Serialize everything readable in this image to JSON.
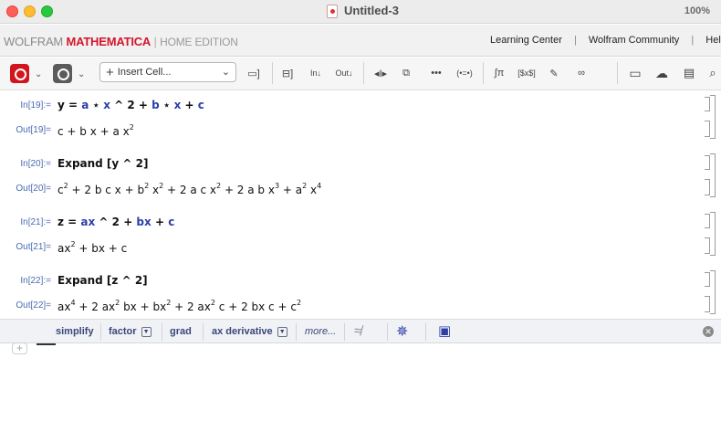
{
  "window": {
    "title": "Untitled-3",
    "zoom": "100%"
  },
  "brand": {
    "wolfram": "WOLFRAM",
    "mathematica": "MATHEMATICA",
    "separator": "|",
    "edition": "HOME EDITION"
  },
  "top_links": [
    {
      "label": "Learning Center"
    },
    {
      "label": "Wolfram Community"
    },
    {
      "label": "Hel"
    }
  ],
  "toolbar": {
    "insert_cell_label": "Insert Cell..."
  },
  "cells": [
    {
      "in_label": "In[19]:=",
      "input_parts": [
        [
          "y = ",
          false
        ],
        [
          "a",
          true
        ],
        [
          " ⋆ ",
          false
        ],
        [
          "x",
          true
        ],
        [
          " ^ 2  +  ",
          false
        ],
        [
          "b",
          true
        ],
        [
          " ⋆ ",
          false
        ],
        [
          "x",
          true
        ],
        [
          "  +  ",
          false
        ],
        [
          "c",
          true
        ]
      ],
      "out_label": "Out[19]=",
      "output_html": "c + b x + a x<sup>2</sup>"
    },
    {
      "in_label": "In[20]:=",
      "input_parts": [
        [
          "Expand [y ^ 2]",
          false
        ]
      ],
      "out_label": "Out[20]=",
      "output_html": "c<sup>2</sup> + 2 b c x + b<sup>2</sup> x<sup>2</sup> + 2 a c x<sup>2</sup> + 2 a b x<sup>3</sup> + a<sup>2</sup> x<sup>4</sup>"
    },
    {
      "in_label": "In[21]:=",
      "input_parts": [
        [
          "z = ",
          false
        ],
        [
          "ax",
          true
        ],
        [
          " ^ 2  + ",
          false
        ],
        [
          "bx",
          true
        ],
        [
          "  +  ",
          false
        ],
        [
          "c",
          true
        ]
      ],
      "out_label": "Out[21]=",
      "output_html": "ax<sup>2</sup> + bx + c"
    },
    {
      "in_label": "In[22]:=",
      "input_parts": [
        [
          "Expand [z ^ 2]",
          false
        ]
      ],
      "out_label": "Out[22]=",
      "output_html": "ax<sup>4</sup> + 2 ax<sup>2</sup> bx + bx<sup>2</sup> + 2 ax<sup>2</sup> c + 2 bx c + c<sup>2</sup>"
    }
  ],
  "suggestions": {
    "simplify": "simplify",
    "factor": "factor",
    "grad": "grad",
    "ax_derivative": "ax derivative",
    "more": "more..."
  },
  "colors": {
    "brand_red": "#d3152b",
    "variable_blue": "#2c3fa8",
    "label_blue": "#4a6cb0",
    "suggest_text": "#39477a"
  }
}
